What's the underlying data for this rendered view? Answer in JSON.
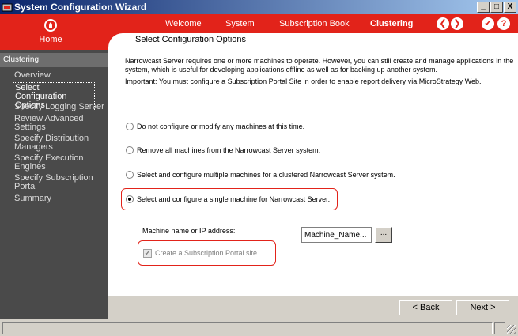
{
  "window": {
    "title": "System Configuration Wizard",
    "min": "_",
    "max": "□",
    "close": "X"
  },
  "header": {
    "home_label": "Home",
    "tabs": [
      "Welcome",
      "System",
      "Subscription Book",
      "Clustering"
    ],
    "back_arrow": "❮",
    "forward_arrow": "❯",
    "finish": "✔",
    "help": "?"
  },
  "sidebar": {
    "heading": "Clustering",
    "items": [
      "Overview",
      "Select Configuration Options",
      "Specify Logging Server",
      "Review Advanced Settings",
      "Specify Distribution Managers",
      "Specify Execution Engines",
      "Specify Subscription Portal",
      "Summary"
    ]
  },
  "main": {
    "title": "Select Configuration Options",
    "intro": "Narrowcast Server requires one or more machines to operate. However, you can still create and manage applications in the system, which is useful for developing applications offline as well as for backing up another system.",
    "important": "Important: You must configure a Subscription Portal Site in order to enable report delivery via MicroStrategy Web.",
    "options": [
      "Do not configure or modify any machines at this time.",
      "Remove all machines from the Narrowcast Server system.",
      "Select and configure multiple machines for a clustered Narrowcast Server system.",
      "Select and configure a single machine for Narrowcast Server."
    ],
    "machine_label": "Machine name or IP address:",
    "machine_value": "Machine_Name...",
    "browse": "...",
    "portal_checkbox": "Create a Subscription Portal site."
  },
  "footer": {
    "back": "< Back",
    "next": "Next >"
  }
}
